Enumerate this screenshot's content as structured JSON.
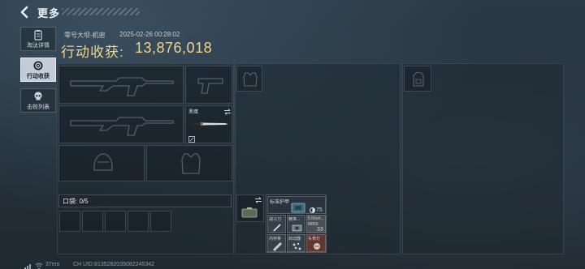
{
  "header": {
    "title": "更多"
  },
  "tabs": [
    {
      "label": "淘汰详情",
      "icon": "clipboard-icon",
      "active": false
    },
    {
      "label": "行动收获",
      "icon": "target-icon",
      "active": true
    },
    {
      "label": "击败列表",
      "icon": "skull-icon",
      "active": false
    }
  ],
  "info": {
    "map_name": "零号大坝-机密",
    "timestamp": "2025-02-26 00:28:02",
    "value_label": "行动收获:",
    "value_amount": "13,876,018"
  },
  "loadout": {
    "knife_label": "黑鹰",
    "pocket_label": "口袋: 0/5",
    "pocket_slots": 5
  },
  "container": {
    "name": "标准护甲",
    "durability": "75",
    "items": [
      {
        "label": "战斗刀",
        "icon": "knife-icon"
      },
      {
        "label": "精准...",
        "icon": "device-icon"
      },
      {
        "label": "5.56x4...",
        "icon": "ammo-icon",
        "sub": "M855",
        "count": "33"
      },
      {
        "label": "内存条",
        "icon": "ram-icon"
      },
      {
        "label": "启动器",
        "icon": "scatter-icon"
      },
      {
        "label": "头骨灯",
        "icon": "skull-lamp-icon"
      }
    ]
  },
  "footer": {
    "ping": "37ms",
    "uid": "CH UID:8135282035082245342"
  },
  "colors": {
    "accent": "#f1d48a",
    "background": "#26323c"
  }
}
